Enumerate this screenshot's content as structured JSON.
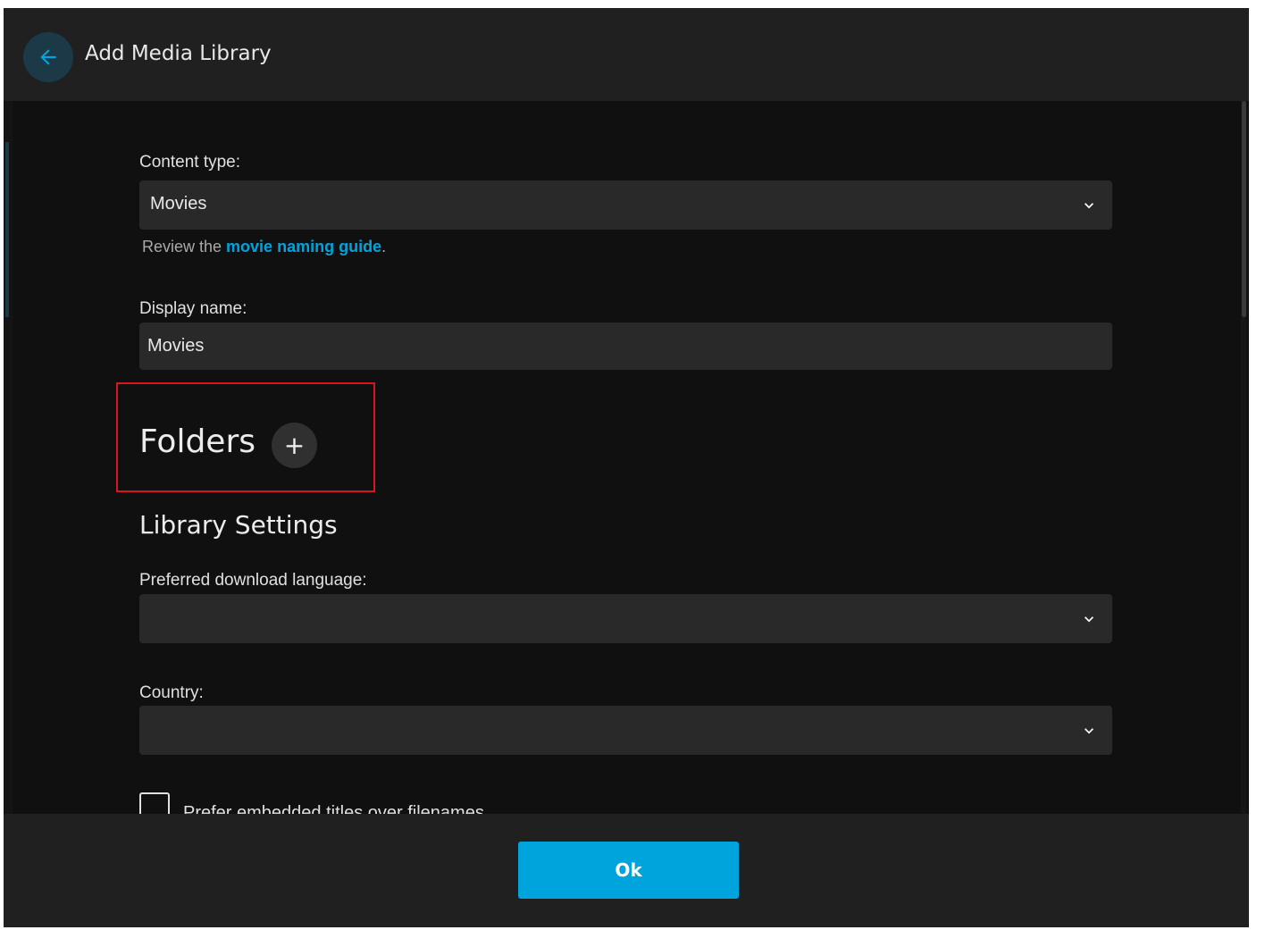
{
  "header": {
    "title": "Add Media Library",
    "back_icon": "arrow-left-icon"
  },
  "form": {
    "content_type": {
      "label": "Content type:",
      "value": "Movies"
    },
    "help": {
      "prefix": "Review the ",
      "link": "movie naming guide",
      "suffix": "."
    },
    "display_name": {
      "label": "Display name:",
      "value": "Movies"
    },
    "folders": {
      "title": "Folders",
      "add_symbol": "+"
    },
    "library_settings": {
      "title": "Library Settings",
      "download_language": {
        "label": "Preferred download language:",
        "value": ""
      },
      "country": {
        "label": "Country:",
        "value": ""
      },
      "embedded_titles": {
        "label": "Prefer embedded titles over filenames",
        "checked": false
      }
    }
  },
  "footer": {
    "ok_label": "Ok"
  },
  "colors": {
    "accent": "#00a4dc",
    "highlight_box": "#d8161e",
    "background": "#101010",
    "header": "#202020",
    "field": "#292929"
  }
}
